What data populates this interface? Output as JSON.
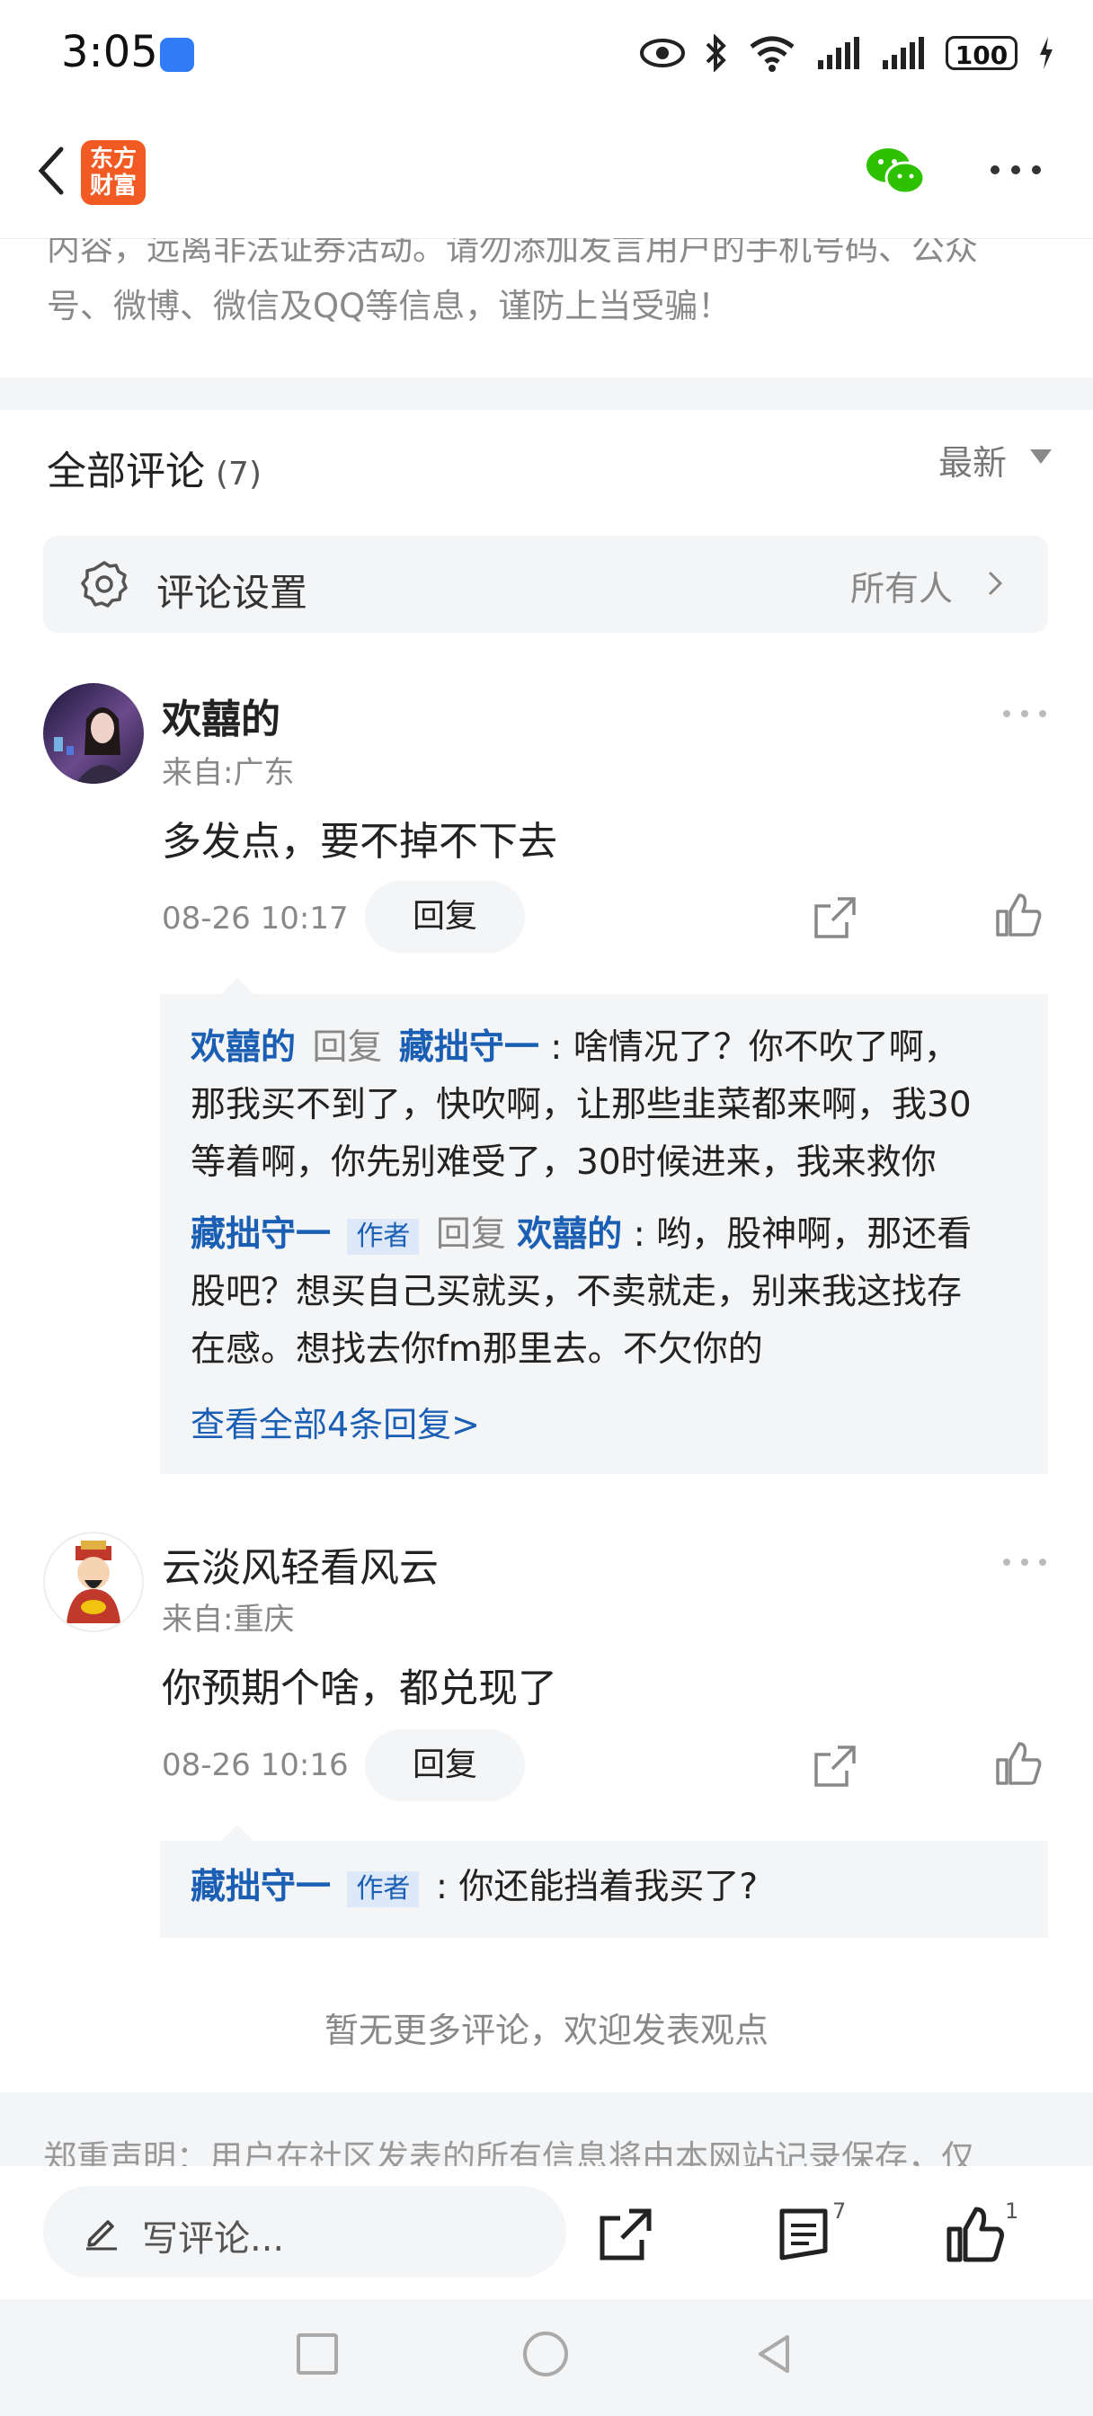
{
  "status_bar": {
    "time": "3:05",
    "battery": "100"
  },
  "header": {
    "logo_line1": "东方",
    "logo_line2": "财富"
  },
  "notice": {
    "line1": "内容，远离非法证券活动。请勿添加发言用户的手机号码、公众",
    "line2": "号、微博、微信及QQ等信息，谨防上当受骗！"
  },
  "comments_section": {
    "title": "全部评论",
    "count": "(7)",
    "sort_label": "最新"
  },
  "settings": {
    "label": "评论设置",
    "value": "所有人"
  },
  "comments": [
    {
      "username": "欢囍的",
      "location": "来自:广东",
      "text": "多发点，要不掉不下去",
      "time": "08-26 10:17",
      "reply_label": "回复",
      "replies": [
        {
          "from": "欢囍的",
          "reply_word": "回复",
          "to": "藏拙守一",
          "lines": [
            ": 啥情况了？你不吹了啊，",
            "那我买不到了，快吹啊，让那些韭菜都来啊，我30",
            "等着啊，你先别难受了，30时候进来，我来救你"
          ]
        },
        {
          "from": "藏拙守一",
          "tag": "作者",
          "reply_word": "回复",
          "to": "欢囍的",
          "lines": [
            ": 哟，股神啊，那还看",
            "股吧？想买自己买就买，不卖就走，别来我这找存",
            "在感。想找去你fm那里去。不欠你的"
          ]
        }
      ],
      "view_all": "查看全部4条回复>"
    },
    {
      "username": "云淡风轻看风云",
      "location": "来自:重庆",
      "text": "你预期个啥，都兑现了",
      "time": "08-26 10:16",
      "reply_label": "回复",
      "replies": [
        {
          "from": "藏拙守一",
          "tag": "作者",
          "lines": [
            ": 你还能挡着我买了?"
          ]
        }
      ]
    }
  ],
  "no_more": "暂无更多评论，欢迎发表观点",
  "disclaimer": "郑重声明：用户在社区发表的所有信息将由本网站记录保存，仅",
  "bottom_bar": {
    "write_placeholder": "写评论...",
    "comments_count": "7",
    "likes_count": "1"
  },
  "colors": {
    "link_blue": "#1a5fb4",
    "brand_orange": "#f15a22",
    "wechat_green": "#2dc100"
  }
}
